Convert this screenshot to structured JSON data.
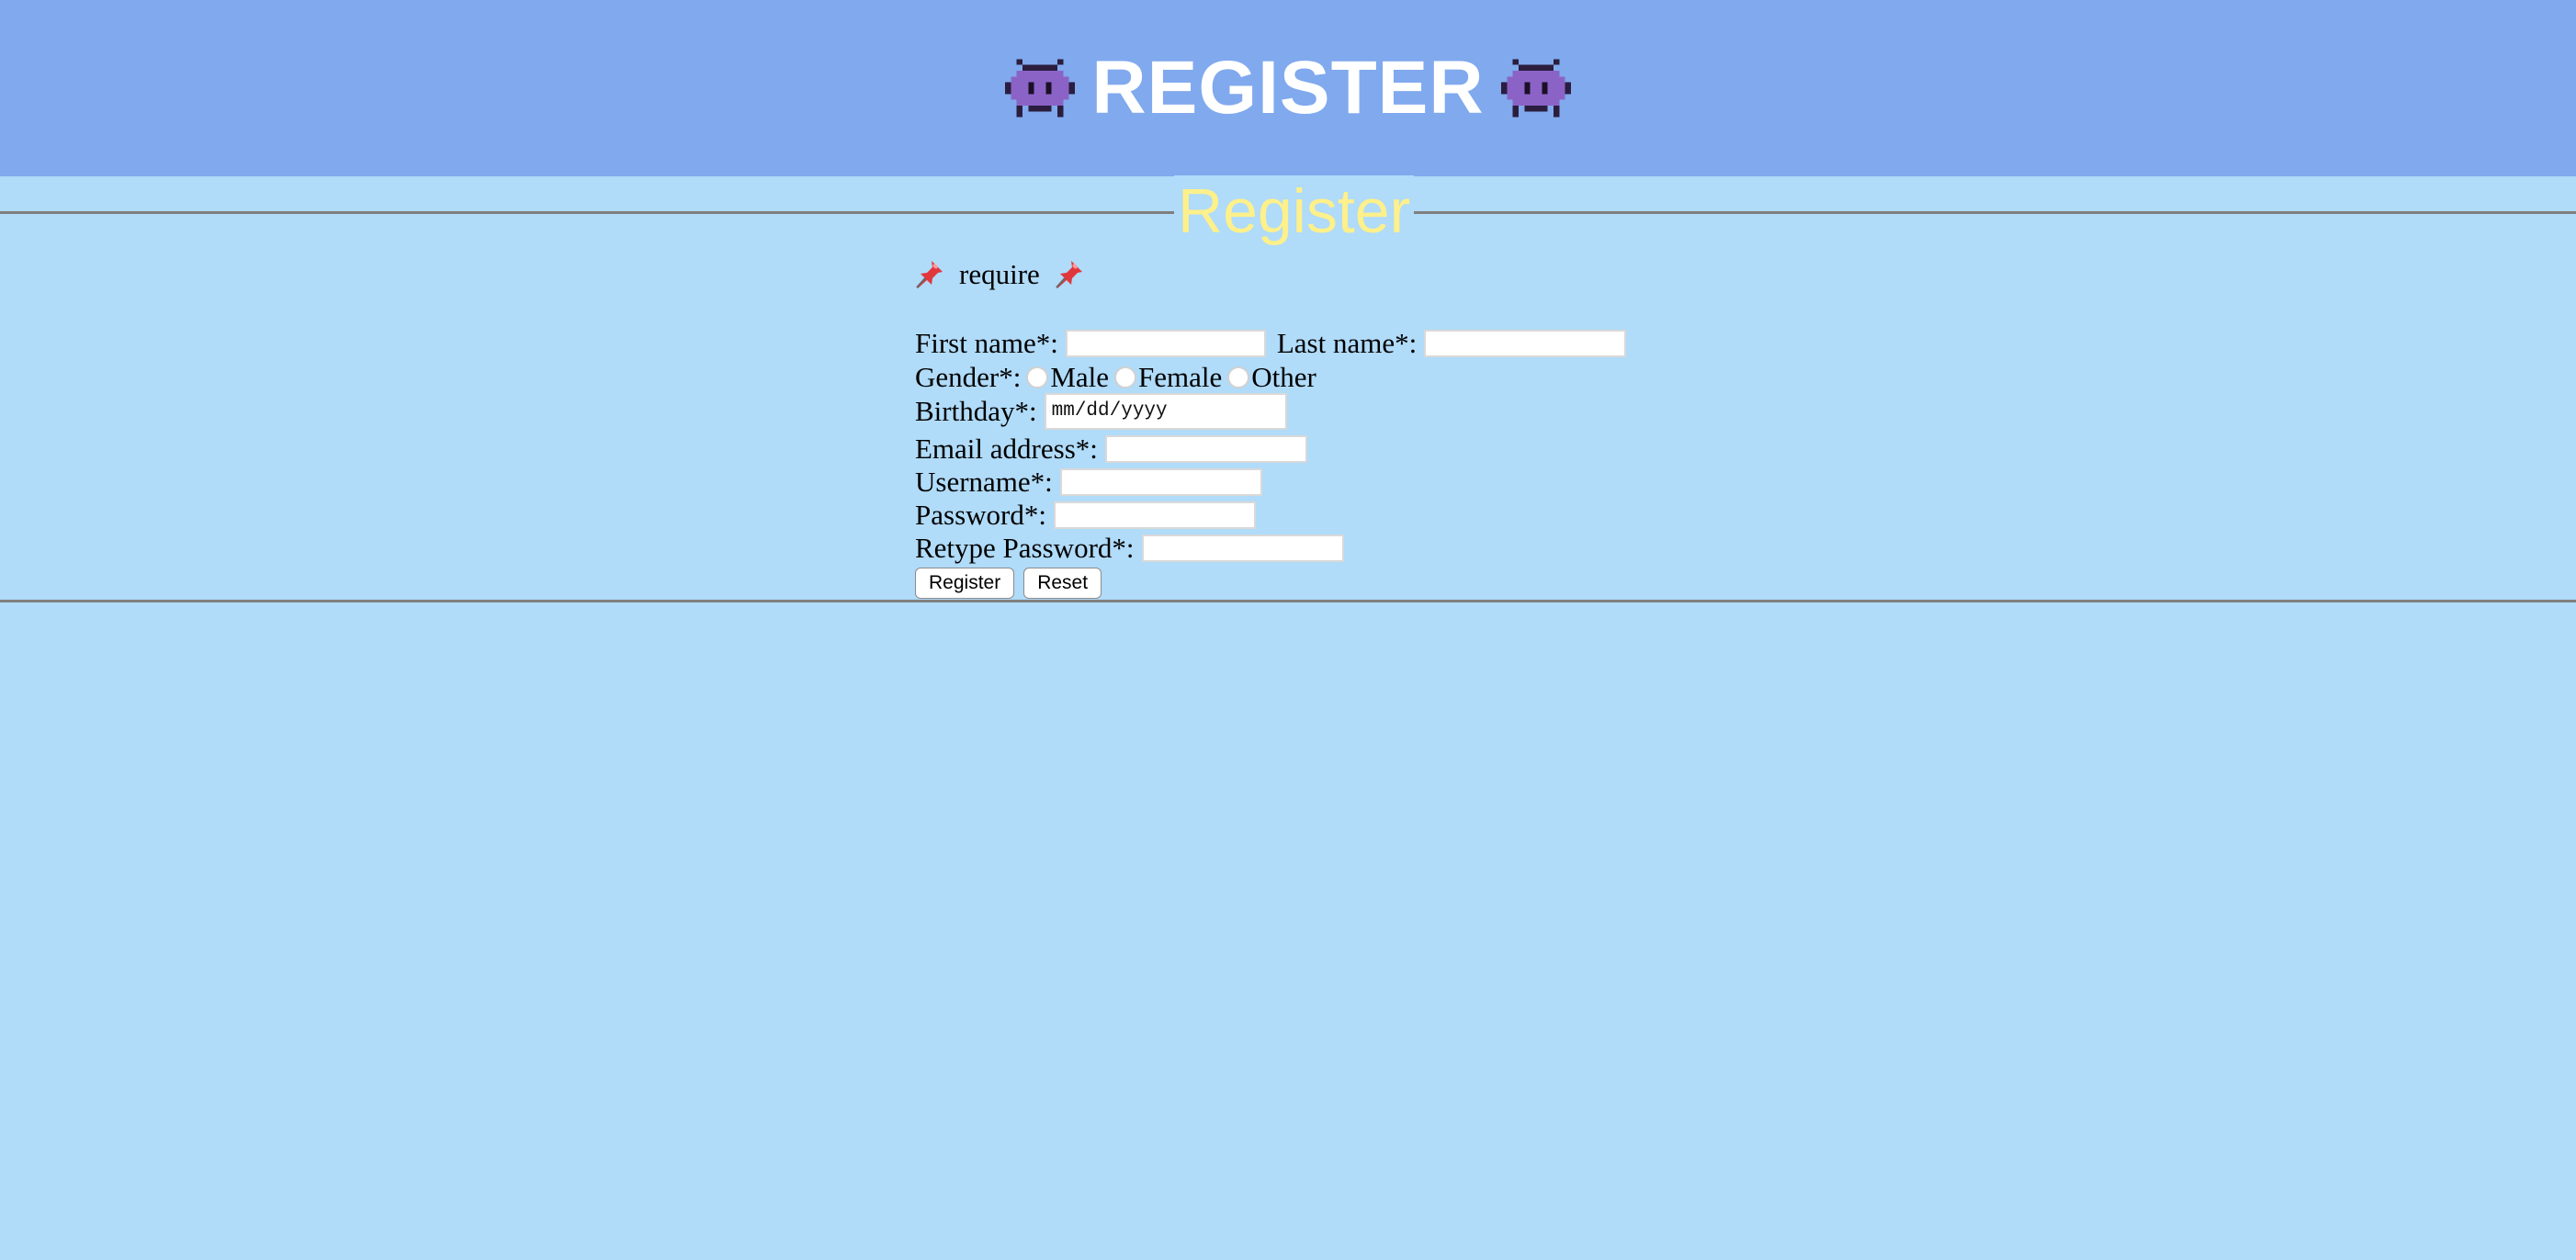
{
  "header": {
    "title": "REGISTER",
    "icon_left": "alien-monster-icon",
    "icon_right": "alien-monster-icon"
  },
  "section": {
    "legend": "Register"
  },
  "note": {
    "text": "require",
    "icon": "pushpin-icon"
  },
  "form": {
    "first_name_label": "First name*:",
    "first_name_value": "",
    "last_name_label": "Last name*:",
    "last_name_value": "",
    "gender_label": "Gender*:",
    "gender_options": [
      "Male",
      "Female",
      "Other"
    ],
    "birthday_label": "Birthday*:",
    "birthday_placeholder": "mm/dd/yyyy",
    "email_label": "Email address*:",
    "email_value": "",
    "username_label": "Username*:",
    "username_value": "",
    "password_label": "Password*:",
    "password_value": "",
    "retype_password_label": "Retype Password*:",
    "retype_password_value": "",
    "register_button": "Register",
    "reset_button": "Reset"
  },
  "colors": {
    "header_bg": "#80a9ee",
    "page_bg": "#b0dbf9",
    "legend_text": "#fef08a",
    "title_text": "#ffffff"
  }
}
